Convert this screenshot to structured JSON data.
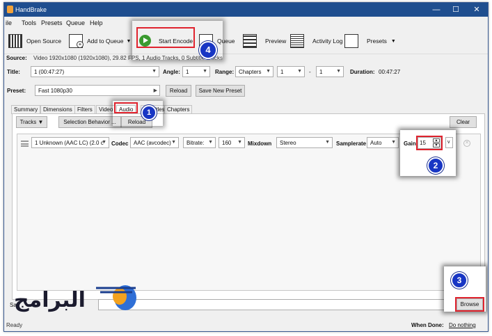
{
  "window": {
    "title": "HandBrake",
    "controls": {
      "minimize": "—",
      "maximize": "☐",
      "close": "✕"
    }
  },
  "menu": [
    "ile",
    "Tools",
    "Presets",
    "Queue",
    "Help"
  ],
  "toolbar": {
    "open_source": "Open Source",
    "add_to_queue": "Add to Queue",
    "start_encode": "Start Encode",
    "queue": "Queue",
    "preview": "Preview",
    "activity_log": "Activity Log",
    "presets": "Presets"
  },
  "source": {
    "label": "Source:",
    "value": "Video  1920x1080 (1920x1080), 29.82 FPS, 1 Audio Tracks, 0 Subtitle Tracks"
  },
  "title_row": {
    "title_label": "Title:",
    "title_value": "1 (00:47:27)",
    "angle_label": "Angle:",
    "angle_value": "1",
    "range_label": "Range:",
    "range_value": "Chapters",
    "range_start": "1",
    "range_dash": "-",
    "range_end": "1",
    "duration_label": "Duration:",
    "duration_value": "00:47:27"
  },
  "preset_row": {
    "label": "Preset:",
    "value": "Fast 1080p30",
    "reload": "Reload",
    "save_new": "Save New Preset"
  },
  "tabs": [
    "Summary",
    "Dimensions",
    "Filters",
    "Video",
    "Audio",
    "Subtitles",
    "Chapters"
  ],
  "audio": {
    "tracks_btn": "Tracks",
    "selection_behavior_btn": "Selection Behavior ...",
    "reload_btn": "Reload",
    "clear_btn": "Clear",
    "track": {
      "source": "1 Unknown (AAC LC) (2.0 c",
      "codec_label": "Codec",
      "codec_value": "AAC (avcodec)",
      "bitrate_value": "Bitrate:",
      "bitrate_num": "160",
      "mixdown_label": "Mixdown",
      "mixdown_value": "Stereo",
      "samplerate_label": "Samplerate",
      "samplerate_value": "Auto",
      "gain_label": "Gain",
      "gain_value": "15",
      "drc_value": "v"
    }
  },
  "save_as": {
    "label": "Sa",
    "browse": "Browse"
  },
  "status": {
    "left": "Ready",
    "when_done_label": "When Done:",
    "when_done_value": "Do nothing"
  },
  "annotations": {
    "b1": "1",
    "b2": "2",
    "b3": "3",
    "b4": "4"
  },
  "watermark": {
    "text": "البرامج"
  },
  "colors": {
    "titlebar": "#1f4e8f",
    "highlight_red": "#e0232e",
    "badge_blue": "#1836c4",
    "play_green": "#3a9a2f"
  }
}
